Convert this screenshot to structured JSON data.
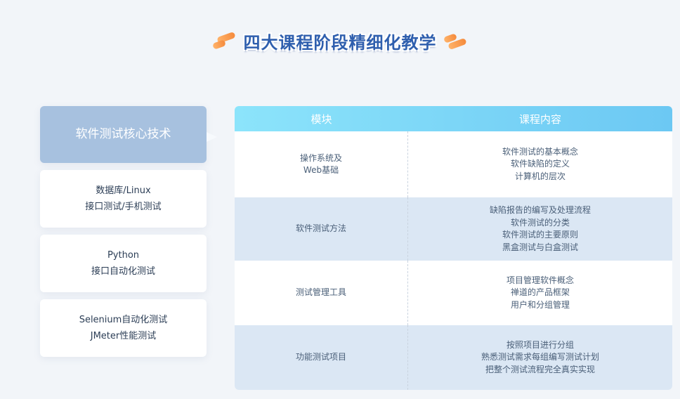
{
  "header": {
    "title": "四大课程阶段精细化教学"
  },
  "sidebar": {
    "items": [
      {
        "lines": [
          "软件测试核心技术"
        ],
        "active": true
      },
      {
        "lines": [
          "数据库/Linux",
          "接口测试/手机测试"
        ],
        "active": false
      },
      {
        "lines": [
          "Python",
          "接口自动化测试"
        ],
        "active": false
      },
      {
        "lines": [
          "Selenium自动化测试",
          "JMeter性能测试"
        ],
        "active": false
      }
    ]
  },
  "table": {
    "headers": [
      "模块",
      "课程内容"
    ],
    "rows": [
      {
        "module": [
          "操作系统及",
          "Web基础"
        ],
        "content": [
          "软件测试的基本概念",
          "软件缺陷的定义",
          "计算机的层次"
        ]
      },
      {
        "module": [
          "软件测试方法"
        ],
        "content": [
          "缺陷报告的编写及处理流程",
          "软件测试的分类",
          "软件测试的主要原则",
          "黑盒测试与白盒测试"
        ]
      },
      {
        "module": [
          "测试管理工具"
        ],
        "content": [
          "项目管理软件概念",
          "禅道的产品框架",
          "用户和分组管理"
        ]
      },
      {
        "module": [
          "功能测试项目"
        ],
        "content": [
          "按照项目进行分组",
          "熟悉测试需求每组编写测试计划",
          "把整个测试流程完全真实实现"
        ]
      }
    ]
  },
  "colors": {
    "title": "#2f5fae",
    "active_tab": "#a7c1df",
    "header_gradient_start": "#8ce4fb",
    "header_gradient_end": "#6cc8f3",
    "row_blue": "#dbe7f4",
    "deco_orange": "#f58a3c"
  }
}
